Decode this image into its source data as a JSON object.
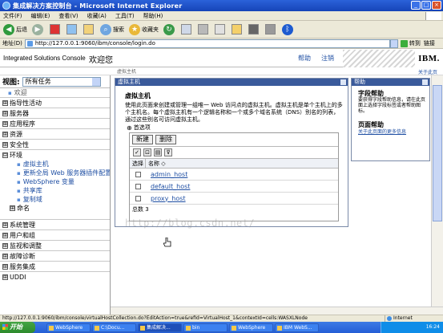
{
  "window": {
    "title": "集成解决方案控制台 - Microsoft Internet Explorer"
  },
  "menubar": {
    "items": [
      "文件(F)",
      "编辑(E)",
      "查看(V)",
      "收藏(A)",
      "工具(T)",
      "帮助(H)"
    ]
  },
  "toolbar": {
    "back": "后退",
    "search": "搜索",
    "favorites": "收藏夹"
  },
  "addressbar": {
    "label": "地址(D)",
    "url": "http://127.0.0.1:9060/ibm/console/login.do",
    "go": "转到",
    "links": "链接"
  },
  "banner": {
    "product": "Integrated Solutions Console",
    "welcome": "欢迎您",
    "help": "帮助",
    "logout": "注销",
    "logo": "IBM.",
    "about": "关于此页"
  },
  "nav": {
    "view_label": "视图:",
    "view_value": "所有任务",
    "welcome": "欢迎",
    "groups": [
      {
        "label": "指导性活动",
        "box": "⊞"
      },
      {
        "label": "服务器",
        "box": "⊞"
      },
      {
        "label": "应用程序",
        "box": "⊞"
      },
      {
        "label": "资源",
        "box": "⊞"
      },
      {
        "label": "安全性",
        "box": "⊞"
      },
      {
        "label": "环境",
        "box": "⊟"
      }
    ],
    "env_items": [
      "虚拟主机",
      "更新全局 Web 服务器插件配置",
      "WebSphere 变量",
      "共享库",
      "复制域"
    ],
    "naming": "命名",
    "groups2": [
      {
        "label": "系统管理",
        "box": "⊞"
      },
      {
        "label": "用户和组",
        "box": "⊞"
      },
      {
        "label": "监视和调整",
        "box": "⊞"
      },
      {
        "label": "故障诊断",
        "box": "⊞"
      },
      {
        "label": "服务集成",
        "box": "⊞"
      },
      {
        "label": "UDDI",
        "box": "⊞"
      }
    ]
  },
  "main": {
    "breadcrumb": "虚拟主机",
    "panel_title": "虚拟主机",
    "heading": "虚拟主机",
    "description": "使用此页面来创建或管理一组唯一 Web 访问点的虚拟主机。虚拟主机是单个主机上的多个主机名。每个虚拟主机有一个逻辑名称和一个或多个域名系统（DNS）别名的列表，通过这些别名可访问虚拟主机。",
    "preferences": "首选项",
    "new_button": "新建",
    "delete_button": "删除",
    "col_select": "选择",
    "col_name": "名称 ◇",
    "rows": [
      "admin_host",
      "default_host",
      "proxy_host"
    ],
    "total": "总数 3"
  },
  "help": {
    "title": "帮助",
    "field_help_title": "字段帮助",
    "field_help_text": "要获得字段帮助信息，请在此页面上选择字段标签或者帮助图标。",
    "page_help_title": "页面帮助",
    "page_help_link": "关于此页面的更多信息"
  },
  "watermark": "http://blog.csdn.net/",
  "statusbar": {
    "url": "http://127.0.0.1:9060/ibm/console/virtualHostCollection.do?EditAction=true&refId=VirtualHost_1&contextId=cells:WASXLNode",
    "zone": "Internet"
  },
  "taskbar": {
    "start": "开始",
    "tasks": [
      "WebSphere",
      "C:\\Docu...",
      "集成解决...",
      "bin",
      "WebSphere",
      "IBM WebS..."
    ],
    "clock": "16:24"
  },
  "colors": {
    "panel_header": "#3a5a9b",
    "link": "#1f4fa3",
    "taskbar": "#245ed6"
  }
}
